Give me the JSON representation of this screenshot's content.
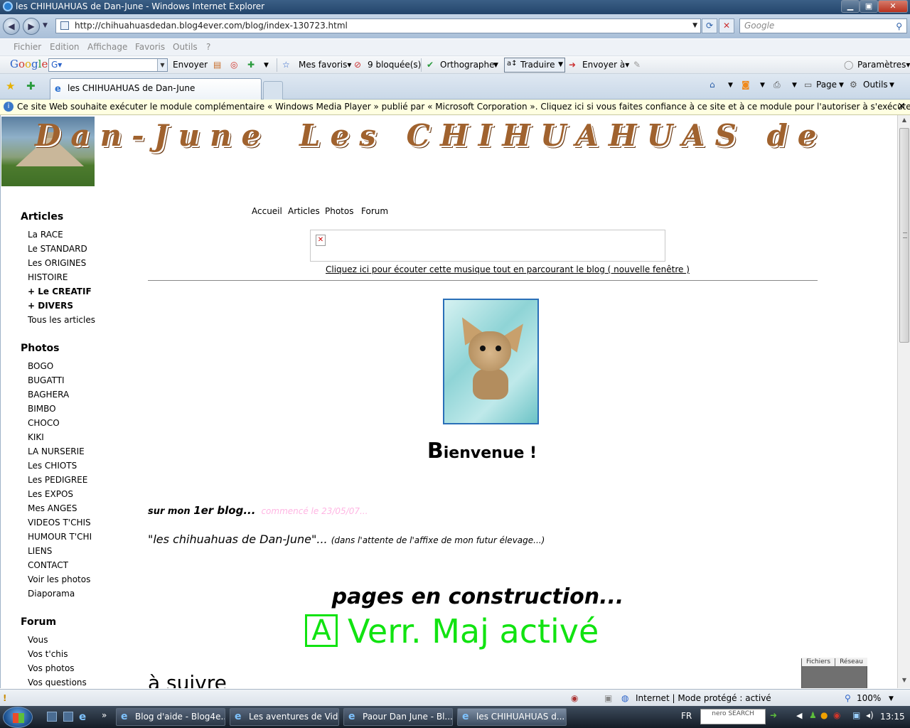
{
  "window": {
    "title": "les CHIHUAHUAS de Dan-June - Windows Internet Explorer",
    "buttons": {
      "minimize": "▁",
      "maximize": "▣",
      "close": "✕"
    }
  },
  "address_bar": {
    "url": "http://chihuahuasdedan.blog4ever.com/blog/index-130723.html",
    "search_placeholder": "Google"
  },
  "menu": [
    "Fichier",
    "Edition",
    "Affichage",
    "Favoris",
    "Outils",
    "?"
  ],
  "google_toolbar": {
    "logo": [
      "G",
      "o",
      "o",
      "g",
      "l",
      "e"
    ],
    "box_text": "G▾",
    "send_label": "Envoyer",
    "favorites_label": "Mes favoris▾",
    "blocked_label": "9 bloquée(s)",
    "spell_label": "Orthographe",
    "translate_label": "Traduire",
    "send_to_label": "Envoyer à▾",
    "settings_label": "Paramètres▾"
  },
  "tabs": [
    {
      "label": "les CHIHUAHUAS de Dan-June"
    }
  ],
  "command_bar": {
    "page_label": "Page",
    "tools_label": "Outils"
  },
  "info_bar": {
    "text": "Ce site Web souhaite exécuter le module complémentaire « Windows Media Player » publié par « Microsoft Corporation ». Cliquez ici si vous faites confiance à ce site et à ce module pour l'autoriser à s'exécuter..."
  },
  "page": {
    "header_left": "Dan-June",
    "header_right": "Les CHIHUAHUAS de",
    "nav": [
      "Accueil",
      "Articles",
      "Photos",
      "Forum"
    ],
    "music_link": "Cliquez ici pour écouter cette musique tout en parcourant le blog ( nouvelle fenêtre )",
    "welcome_cap": "B",
    "welcome_rest": "ienvenue !",
    "first_blog_a": "sur mon ",
    "first_blog_b": "1er blog...",
    "first_blog_date": "commencé le 23/05/07...",
    "blog_name": "\"les chihuahuas de Dan-June\"...",
    "blog_name_note": "(dans l'attente de l'affixe de mon futur élevage...)",
    "construction": "pages en construction...",
    "capslock_letter": "A",
    "capslock_text": "Verr. Maj activé",
    "suivre": "à suivre",
    "netmeter_labels": [
      "Fichiers",
      "Réseau"
    ]
  },
  "sidebar": {
    "articles_title": "Articles",
    "articles": [
      {
        "label": "La RACE",
        "bold": false
      },
      {
        "label": "Le STANDARD",
        "bold": false
      },
      {
        "label": "Les ORIGINES",
        "bold": false
      },
      {
        "label": "HISTOIRE",
        "bold": false
      },
      {
        "label": "+ Le CREATIF",
        "bold": true
      },
      {
        "label": "+ DIVERS",
        "bold": true
      },
      {
        "label": "Tous les articles",
        "bold": false
      }
    ],
    "photos_title": "Photos",
    "photos": [
      "BOGO",
      "BUGATTI",
      "BAGHERA",
      "BIMBO",
      "CHOCO",
      "KIKI",
      "LA NURSERIE",
      "Les CHIOTS",
      "Les PEDIGREE",
      "Les EXPOS",
      "Mes ANGES",
      "VIDEOS T'CHIS",
      "HUMOUR T'CHI",
      "LIENS",
      "CONTACT",
      "Voir les photos",
      "Diaporama"
    ],
    "forum_title": "Forum",
    "forum": [
      "Vous",
      "Vos t'chis",
      "Vos photos",
      "Vos questions"
    ]
  },
  "status_bar": {
    "zone": "Internet | Mode protégé : activé",
    "zoom": "100%"
  },
  "taskbar": {
    "tasks": [
      {
        "label": "Blog d'aide - Blog4e..."
      },
      {
        "label": "Les aventures de Vid..."
      },
      {
        "label": "Paour Dan June - Bl..."
      },
      {
        "label": "les CHIHUAHUAS d..."
      }
    ],
    "language": "FR",
    "nero_label": "nero SEARCH",
    "clock": "13:15"
  },
  "colors": {
    "title_gradient_top": "#3b5f86",
    "header_brown": "#a0622e",
    "capslock_green": "#11e311",
    "date_pink": "#ffb6e3"
  }
}
